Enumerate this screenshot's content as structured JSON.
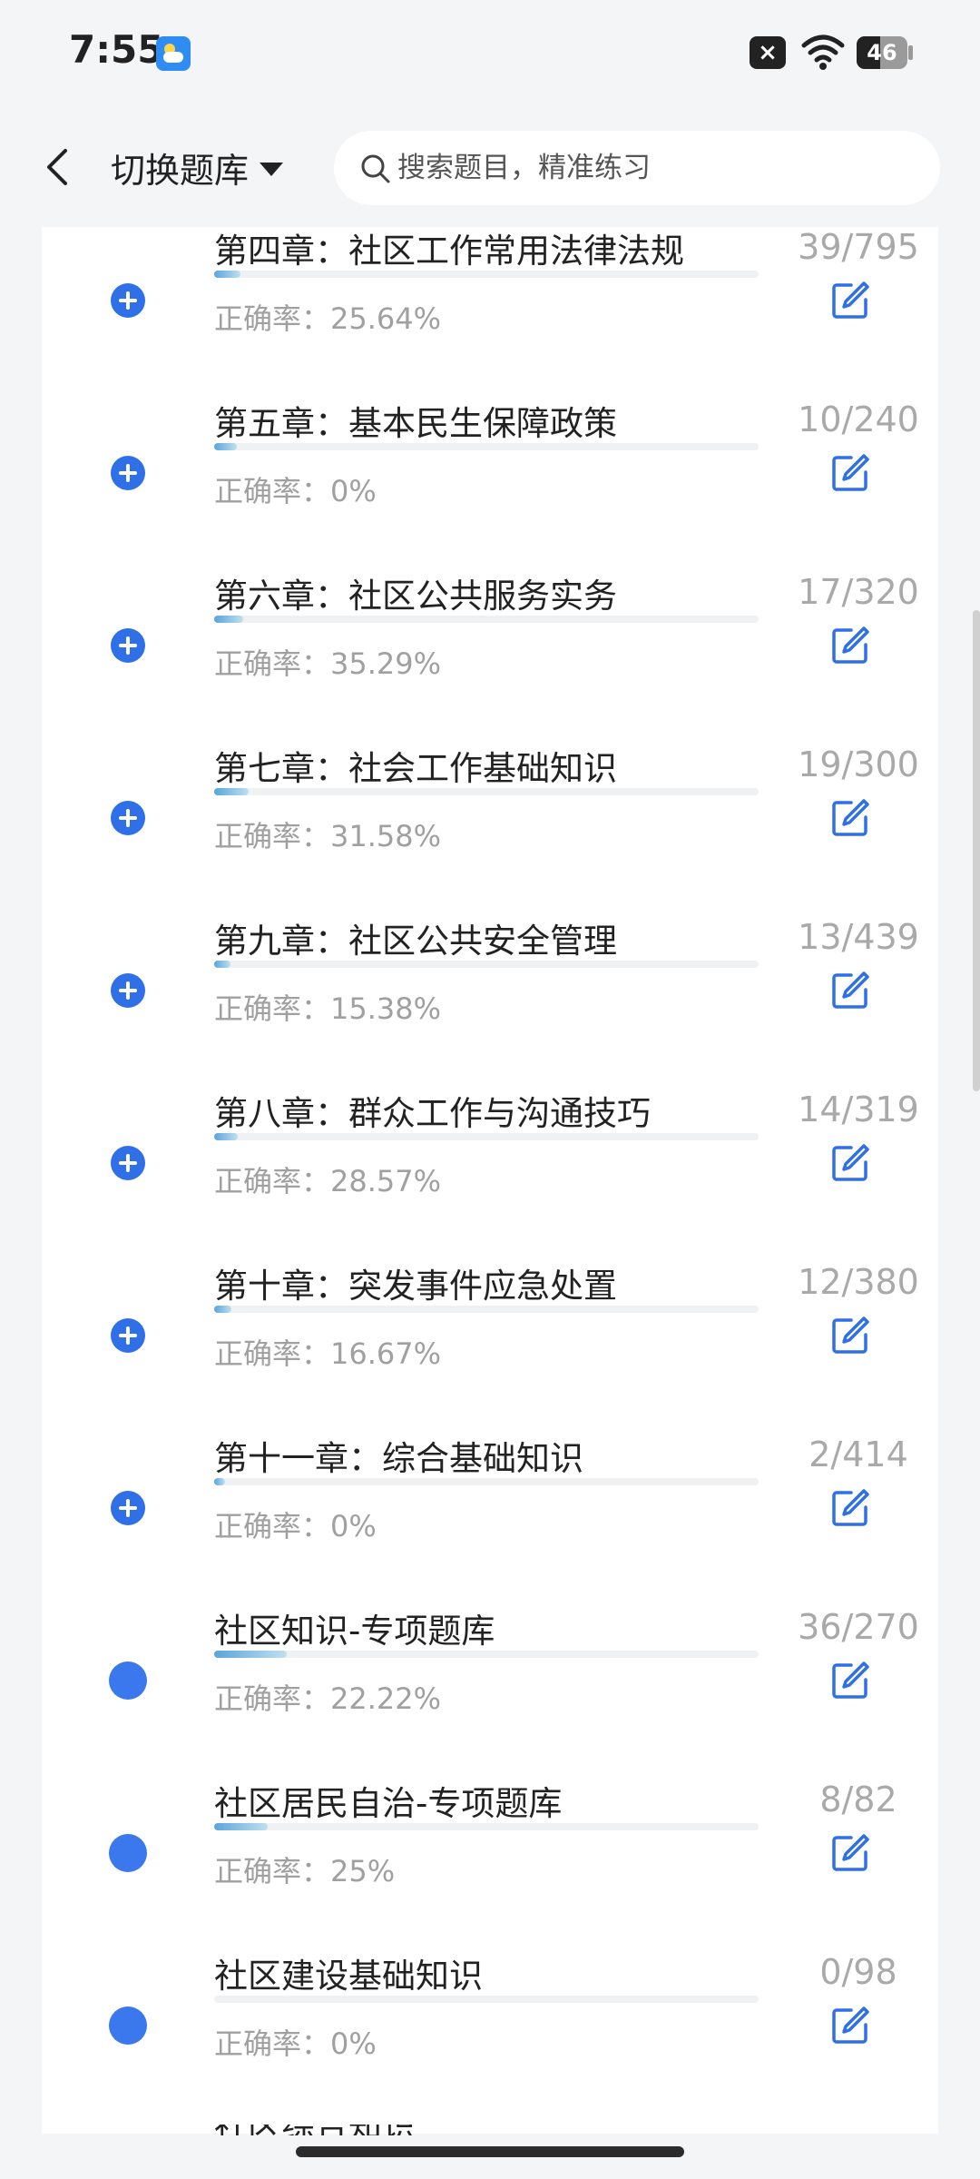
{
  "status_bar": {
    "time": "7:55",
    "battery": "46",
    "battery_level": 0.46,
    "icons": [
      "weather-icon",
      "close-icon",
      "wifi-icon",
      "battery-icon"
    ]
  },
  "header": {
    "back_icon": "chevron-left-icon",
    "switch_label": "切换题库",
    "search_placeholder": "搜索题目，精准练习"
  },
  "colors": {
    "accent": "#2f6fe8",
    "progress_start": "#5aa4dc",
    "progress_end": "#bfe0ef",
    "muted_text": "#a0a0a0"
  },
  "chapters": [
    {
      "title": "第四章：社区工作常用法律法规",
      "accuracy_label": "正确率：",
      "accuracy": "25.64%",
      "count": "39/795",
      "done": 39,
      "total": 795,
      "icon": "plus-circle-icon"
    },
    {
      "title": "第五章：基本民生保障政策",
      "accuracy_label": "正确率：",
      "accuracy": "0%",
      "count": "10/240",
      "done": 10,
      "total": 240,
      "icon": "plus-circle-icon"
    },
    {
      "title": "第六章：社区公共服务实务",
      "accuracy_label": "正确率：",
      "accuracy": "35.29%",
      "count": "17/320",
      "done": 17,
      "total": 320,
      "icon": "plus-circle-icon"
    },
    {
      "title": "第七章：社会工作基础知识",
      "accuracy_label": "正确率：",
      "accuracy": "31.58%",
      "count": "19/300",
      "done": 19,
      "total": 300,
      "icon": "plus-circle-icon"
    },
    {
      "title": "第九章：社区公共安全管理",
      "accuracy_label": "正确率：",
      "accuracy": "15.38%",
      "count": "13/439",
      "done": 13,
      "total": 439,
      "icon": "plus-circle-icon"
    },
    {
      "title": "第八章：群众工作与沟通技巧",
      "accuracy_label": "正确率：",
      "accuracy": "28.57%",
      "count": "14/319",
      "done": 14,
      "total": 319,
      "icon": "plus-circle-icon"
    },
    {
      "title": "第十章：突发事件应急处置",
      "accuracy_label": "正确率：",
      "accuracy": "16.67%",
      "count": "12/380",
      "done": 12,
      "total": 380,
      "icon": "plus-circle-icon"
    },
    {
      "title": "第十一章：综合基础知识",
      "accuracy_label": "正确率：",
      "accuracy": "0%",
      "count": "2/414",
      "done": 2,
      "total": 414,
      "icon": "plus-circle-icon"
    },
    {
      "title": "社区知识-专项题库",
      "accuracy_label": "正确率：",
      "accuracy": "22.22%",
      "count": "36/270",
      "done": 36,
      "total": 270,
      "icon": "dot-icon"
    },
    {
      "title": "社区居民自治-专项题库",
      "accuracy_label": "正确率：",
      "accuracy": "25%",
      "count": "8/82",
      "done": 8,
      "total": 82,
      "icon": "dot-icon"
    },
    {
      "title": "社区建设基础知识",
      "accuracy_label": "正确率：",
      "accuracy": "0%",
      "count": "0/98",
      "done": 0,
      "total": 98,
      "icon": "dot-icon"
    }
  ],
  "partial_item": {
    "title": "社区综合知识"
  }
}
